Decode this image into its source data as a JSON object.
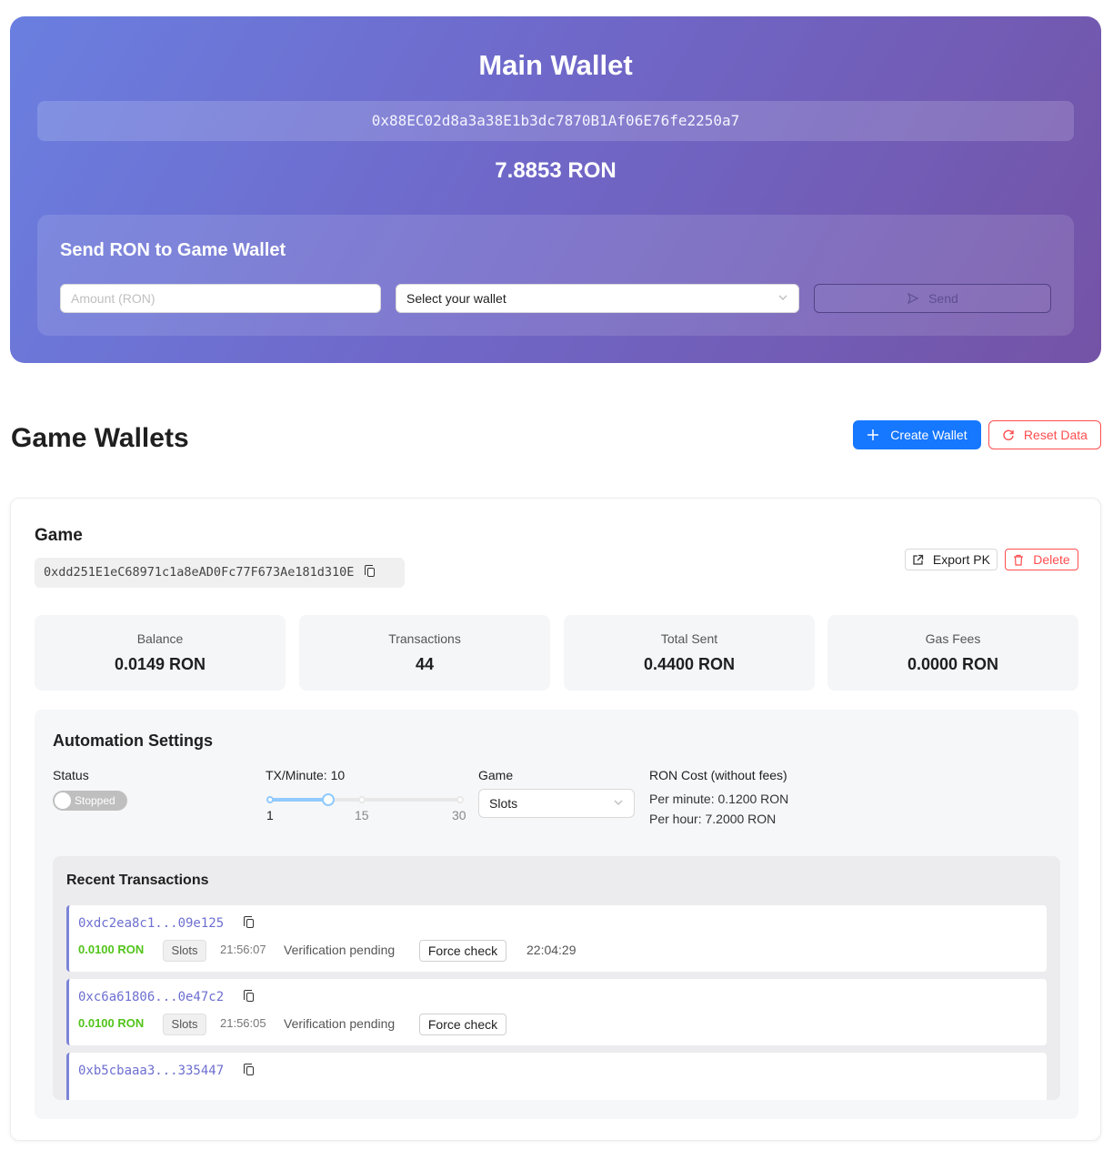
{
  "main_wallet": {
    "title": "Main Wallet",
    "address": "0x88EC02d8a3a38E1b3dc7870B1Af06E76fe2250a7",
    "balance": "7.8853 RON",
    "send_panel": {
      "title": "Send RON to Game Wallet",
      "amount_placeholder": "Amount (RON)",
      "wallet_select_value": "Select your wallet",
      "send_label": "Send"
    }
  },
  "game_wallets": {
    "title": "Game Wallets",
    "create_label": "Create Wallet",
    "reset_label": "Reset Data"
  },
  "wallet_card": {
    "name": "Game",
    "address": "0xdd251E1eC68971c1a8eAD0Fc77F673Ae181d310E",
    "export_label": "Export PK",
    "delete_label": "Delete",
    "stats": [
      {
        "label": "Balance",
        "value": "0.0149 RON"
      },
      {
        "label": "Transactions",
        "value": "44"
      },
      {
        "label": "Total Sent",
        "value": "0.4400 RON"
      },
      {
        "label": "Gas Fees",
        "value": "0.0000 RON"
      }
    ],
    "automation": {
      "title": "Automation Settings",
      "status_label": "Status",
      "status_value": "Stopped",
      "status_on": false,
      "tx_label": "TX/Minute: 10",
      "tx_value": 10,
      "tx_min": 1,
      "tx_max": 30,
      "tx_marks": [
        "1",
        "15",
        "30"
      ],
      "game_label": "Game",
      "game_value": "Slots",
      "cost_label": "RON Cost (without fees)",
      "cost_per_minute": "Per minute: 0.1200 RON",
      "cost_per_hour": "Per hour: 7.2000 RON"
    },
    "recent": {
      "title": "Recent Transactions",
      "items": [
        {
          "hash": "0xdc2ea8c1...09e125",
          "amount": "0.0100 RON",
          "game": "Slots",
          "time": "21:56:07",
          "status": "Verification pending",
          "action": "Force check",
          "checked_at": "22:04:29"
        },
        {
          "hash": "0xc6a61806...0e47c2",
          "amount": "0.0100 RON",
          "game": "Slots",
          "time": "21:56:05",
          "status": "Verification pending",
          "action": "Force check",
          "checked_at": ""
        },
        {
          "hash": "0xb5cbaaa3...335447"
        }
      ]
    }
  },
  "colors": {
    "primary": "#1677ff",
    "danger": "#ff4d4f",
    "success": "#52c41a",
    "hash": "#6d6fd0",
    "gradient_start": "#6a7fe0",
    "gradient_end": "#7453a6"
  },
  "icons": {
    "send": "send-icon",
    "plus": "plus-icon",
    "reload": "reload-icon",
    "copy": "copy-icon",
    "export": "export-icon",
    "delete": "trash-icon",
    "chevron": "chevron-down-icon"
  }
}
